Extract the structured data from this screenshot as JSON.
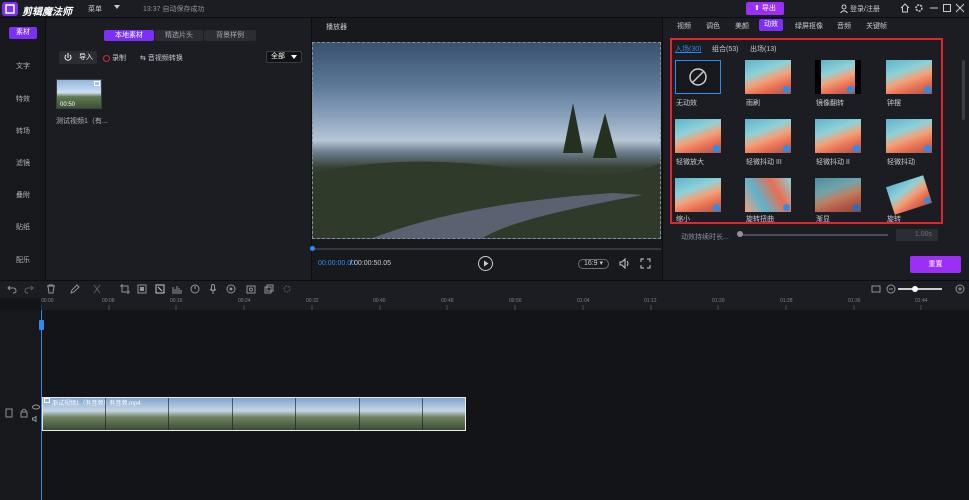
{
  "topbar": {
    "app_title": "剪辑魔法师",
    "menu_label": "菜单",
    "autosave": "13:37 自动保存成功",
    "export_label": "导出",
    "login_label": "登录/注册"
  },
  "left_nav": {
    "items": [
      "素材",
      "文字",
      "特效",
      "转场",
      "滤镜",
      "叠附",
      "贴纸",
      "配乐"
    ]
  },
  "media": {
    "tabs": [
      "本地素材",
      "精选片头",
      "背景样例"
    ],
    "import_label": "导入",
    "record_label": "录制",
    "convert_label": "音视频转换",
    "filter_label": "全部",
    "clip": {
      "duration": "00:50",
      "name": "测试视频1（有..."
    }
  },
  "player": {
    "title": "播放器",
    "time_current": "00:00:00.00",
    "time_sep": "/",
    "time_total": "00:00:50.05",
    "ratio": "16:9",
    "progress": 0
  },
  "right": {
    "tabs": [
      "视频",
      "调色",
      "美颜",
      "动效",
      "绿屏抠像",
      "音频",
      "关键帧"
    ],
    "active_tab": "动效",
    "subtabs": [
      "入场(30)",
      "组合(53)",
      "出场(13)"
    ],
    "effects": [
      {
        "label": "无动效"
      },
      {
        "label": "雨刷"
      },
      {
        "label": "镜像翻转"
      },
      {
        "label": "钟摆"
      },
      {
        "label": "轻微放大"
      },
      {
        "label": "轻微抖动 III"
      },
      {
        "label": "轻微抖动 II"
      },
      {
        "label": "轻微抖动"
      },
      {
        "label": "缩小"
      },
      {
        "label": "旋转扭曲"
      },
      {
        "label": "渐显"
      },
      {
        "label": "旋转"
      }
    ],
    "duration_label": "动效持续时长...",
    "duration_value": "1.00s",
    "reset_label": "重置"
  },
  "timeline": {
    "ticks": [
      "00:00",
      "00:08",
      "00:16",
      "00:24",
      "00:32",
      "00:40",
      "00:48",
      "00:56",
      "01:04",
      "01:12",
      "01:20",
      "01:28",
      "01:36",
      "01:44"
    ],
    "clip_name": "测试视频1（有音频）有音频.mp4"
  }
}
